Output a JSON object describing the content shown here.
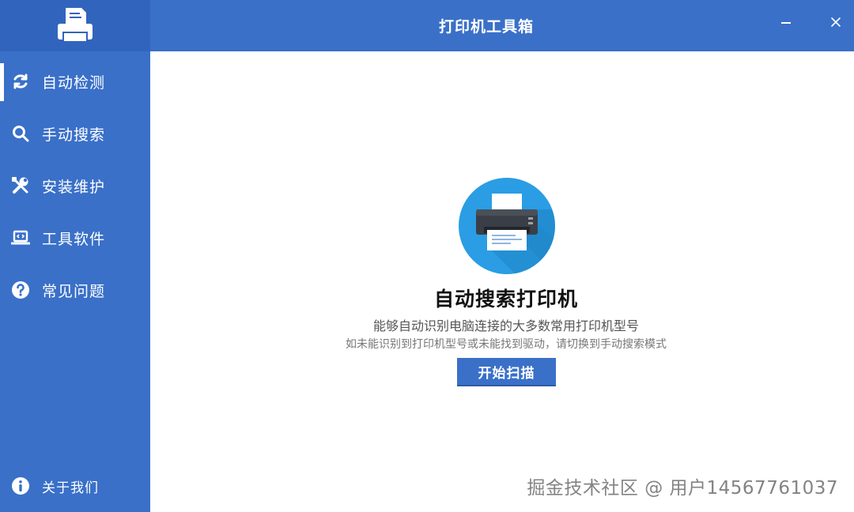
{
  "app": {
    "title": "打印机工具箱"
  },
  "window": {
    "minimize_glyph": "−",
    "close_glyph": "×"
  },
  "sidebar": {
    "items": [
      {
        "label": "自动检测",
        "icon": "refresh-icon",
        "active": true
      },
      {
        "label": "手动搜索",
        "icon": "search-icon",
        "active": false
      },
      {
        "label": "安装维护",
        "icon": "tools-icon",
        "active": false
      },
      {
        "label": "工具软件",
        "icon": "laptop-code-icon",
        "active": false
      },
      {
        "label": "常见问题",
        "icon": "question-circle-icon",
        "active": false
      }
    ],
    "about": {
      "label": "关于我们",
      "icon": "info-circle-icon"
    }
  },
  "main": {
    "heading": "自动搜索打印机",
    "subtitle": "能够自动识别电脑连接的大多数常用打印机型号",
    "hint": "如未能识别到打印机型号或未能找到驱动，请切换到手动搜索模式",
    "scan_button": "开始扫描"
  },
  "watermark": "掘金技术社区 @ 用户14567761037",
  "colors": {
    "brand_blue": "#3a70c8",
    "logo_bg": "#3165bd",
    "hero_circle": "#2a9de4",
    "white": "#ffffff"
  }
}
